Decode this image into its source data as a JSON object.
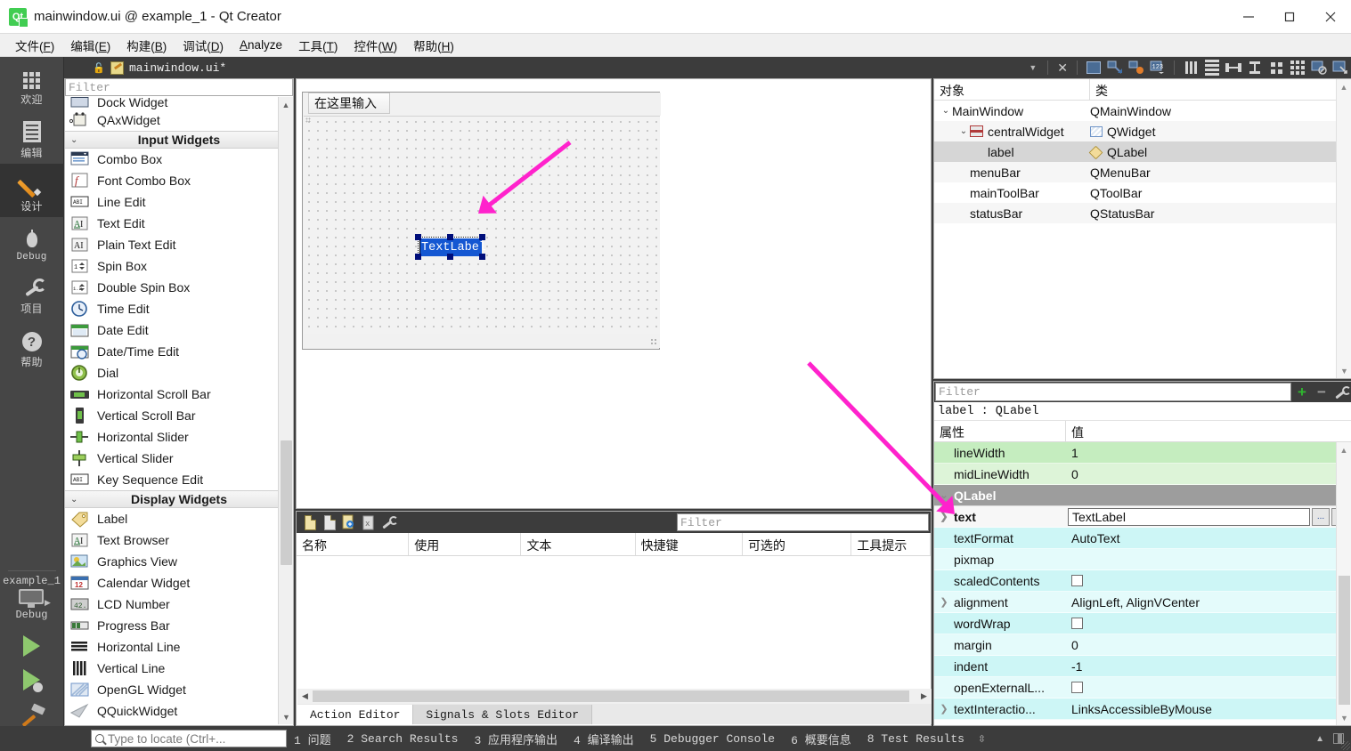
{
  "window": {
    "title": "mainwindow.ui @ example_1 - Qt Creator",
    "logo_text": "Qt",
    "minimize": "minimize-button",
    "maximize": "maximize-button",
    "close": "close-button"
  },
  "menubar": {
    "items": [
      {
        "label": "文件(F)",
        "mnemonic": "F"
      },
      {
        "label": "编辑(E)",
        "mnemonic": "E"
      },
      {
        "label": "构建(B)",
        "mnemonic": "B"
      },
      {
        "label": "调试(D)",
        "mnemonic": "D"
      },
      {
        "label": "Analyze",
        "mnemonic": "A"
      },
      {
        "label": "工具(T)",
        "mnemonic": "T"
      },
      {
        "label": "控件(W)",
        "mnemonic": "W"
      },
      {
        "label": "帮助(H)",
        "mnemonic": "H"
      }
    ]
  },
  "modebar": {
    "modes": [
      {
        "label": "欢迎",
        "icon": "grid-icon",
        "active": false
      },
      {
        "label": "编辑",
        "icon": "document-icon",
        "active": false
      },
      {
        "label": "设计",
        "icon": "pencil-icon",
        "active": true
      },
      {
        "label": "Debug",
        "icon": "bug-icon",
        "active": false
      },
      {
        "label": "项目",
        "icon": "wrench-icon",
        "active": false
      },
      {
        "label": "帮助",
        "icon": "question-icon",
        "active": false
      }
    ],
    "kit": {
      "project": "example_1",
      "config": "Debug",
      "run_label": "run-button",
      "debug_label": "start-debugging-button",
      "build_label": "build-button"
    }
  },
  "widgetbox": {
    "filter_placeholder": "Filter",
    "rows": [
      {
        "type": "item",
        "label": "Dock Widget",
        "icon": "dock-widget-icon",
        "clipped": true
      },
      {
        "type": "item",
        "label": "QAxWidget",
        "icon": "qaxwidget-icon"
      },
      {
        "type": "category",
        "label": "Input Widgets"
      },
      {
        "type": "item",
        "label": "Combo Box",
        "icon": "combo-box-icon"
      },
      {
        "type": "item",
        "label": "Font Combo Box",
        "icon": "font-combo-box-icon"
      },
      {
        "type": "item",
        "label": "Line Edit",
        "icon": "line-edit-icon"
      },
      {
        "type": "item",
        "label": "Text Edit",
        "icon": "text-edit-icon"
      },
      {
        "type": "item",
        "label": "Plain Text Edit",
        "icon": "plain-text-edit-icon"
      },
      {
        "type": "item",
        "label": "Spin Box",
        "icon": "spin-box-icon"
      },
      {
        "type": "item",
        "label": "Double Spin Box",
        "icon": "double-spin-box-icon"
      },
      {
        "type": "item",
        "label": "Time Edit",
        "icon": "time-edit-icon"
      },
      {
        "type": "item",
        "label": "Date Edit",
        "icon": "date-edit-icon"
      },
      {
        "type": "item",
        "label": "Date/Time Edit",
        "icon": "date-time-edit-icon"
      },
      {
        "type": "item",
        "label": "Dial",
        "icon": "dial-icon"
      },
      {
        "type": "item",
        "label": "Horizontal Scroll Bar",
        "icon": "horizontal-scroll-bar-icon"
      },
      {
        "type": "item",
        "label": "Vertical Scroll Bar",
        "icon": "vertical-scroll-bar-icon"
      },
      {
        "type": "item",
        "label": "Horizontal Slider",
        "icon": "horizontal-slider-icon"
      },
      {
        "type": "item",
        "label": "Vertical Slider",
        "icon": "vertical-slider-icon"
      },
      {
        "type": "item",
        "label": "Key Sequence Edit",
        "icon": "key-sequence-edit-icon"
      },
      {
        "type": "category",
        "label": "Display Widgets"
      },
      {
        "type": "item",
        "label": "Label",
        "icon": "label-icon"
      },
      {
        "type": "item",
        "label": "Text Browser",
        "icon": "text-browser-icon"
      },
      {
        "type": "item",
        "label": "Graphics View",
        "icon": "graphics-view-icon"
      },
      {
        "type": "item",
        "label": "Calendar Widget",
        "icon": "calendar-widget-icon"
      },
      {
        "type": "item",
        "label": "LCD Number",
        "icon": "lcd-number-icon"
      },
      {
        "type": "item",
        "label": "Progress Bar",
        "icon": "progress-bar-icon"
      },
      {
        "type": "item",
        "label": "Horizontal Line",
        "icon": "horizontal-line-icon"
      },
      {
        "type": "item",
        "label": "Vertical Line",
        "icon": "vertical-line-icon"
      },
      {
        "type": "item",
        "label": "OpenGL Widget",
        "icon": "opengl-widget-icon"
      },
      {
        "type": "item",
        "label": "QQuickWidget",
        "icon": "qquickwidget-icon"
      }
    ]
  },
  "form_toolbar": {
    "filename": "mainwindow.ui*",
    "lock_icon": "unlocked-icon",
    "dropdown_icon": "chevron-down-icon",
    "close_label": "close-document-button",
    "tools": [
      "edit-widgets-icon",
      "edit-signals-slots-icon",
      "edit-buddies-icon",
      "edit-tab-order-icon",
      "layout-horizontally-icon",
      "layout-vertically-icon",
      "layout-horizontal-splitter-icon",
      "layout-vertical-splitter-icon",
      "layout-in-form-icon",
      "layout-in-grid-icon",
      "break-layout-icon",
      "adjust-size-icon"
    ]
  },
  "canvas": {
    "form_menubar_hint": "在这里输入",
    "selected_widget_text": "TextLabel",
    "selected_widget_name": "label"
  },
  "action_editor": {
    "filter_placeholder": "Filter",
    "toolbar_icons": [
      "new-action-icon",
      "edit-action-icon",
      "copy-action-icon",
      "delete-action-icon",
      "configure-icon"
    ],
    "columns": [
      "名称",
      "使用",
      "文本",
      "快捷键",
      "可选的",
      "工具提示"
    ],
    "rows": [],
    "tabs": [
      {
        "label": "Action Editor",
        "active": true
      },
      {
        "label": "Signals & Slots Editor",
        "active": false
      }
    ]
  },
  "object_inspector": {
    "columns": [
      "对象",
      "类"
    ],
    "rows": [
      {
        "name": "MainWindow",
        "class": "QMainWindow",
        "depth": 0,
        "expandable": true,
        "icon": null,
        "class_icon": null,
        "selected": false
      },
      {
        "name": "centralWidget",
        "class": "QWidget",
        "depth": 1,
        "expandable": true,
        "icon": "central-widget-icon",
        "class_icon": "qwidget-icon",
        "selected": false
      },
      {
        "name": "label",
        "class": "QLabel",
        "depth": 2,
        "expandable": false,
        "icon": null,
        "class_icon": "qlabel-icon",
        "selected": true
      },
      {
        "name": "menuBar",
        "class": "QMenuBar",
        "depth": 1,
        "expandable": false,
        "icon": null,
        "class_icon": null,
        "selected": false
      },
      {
        "name": "mainToolBar",
        "class": "QToolBar",
        "depth": 1,
        "expandable": false,
        "icon": null,
        "class_icon": null,
        "selected": false
      },
      {
        "name": "statusBar",
        "class": "QStatusBar",
        "depth": 1,
        "expandable": false,
        "icon": null,
        "class_icon": null,
        "selected": false
      }
    ]
  },
  "property_editor": {
    "filter_placeholder": "Filter",
    "add_icon": "plus-icon",
    "remove_icon": "minus-icon",
    "configure_icon": "configure-icon",
    "object_header": "label : QLabel",
    "columns": [
      "属性",
      "值"
    ],
    "rows": [
      {
        "name": "lineWidth",
        "value": "1",
        "tone": "green",
        "expandable": false,
        "bold": false,
        "kind": "text"
      },
      {
        "name": "midLineWidth",
        "value": "0",
        "tone": "green2",
        "expandable": false,
        "bold": false,
        "kind": "text"
      },
      {
        "name": "QLabel",
        "value": "",
        "tone": "group",
        "expandable": true,
        "bold": true,
        "kind": "group"
      },
      {
        "name": "text",
        "value": "TextLabel",
        "tone": "white",
        "expandable": true,
        "bold": true,
        "kind": "editor"
      },
      {
        "name": "textFormat",
        "value": "AutoText",
        "tone": "cy1",
        "expandable": false,
        "bold": false,
        "kind": "text"
      },
      {
        "name": "pixmap",
        "value": "",
        "tone": "cy2",
        "expandable": false,
        "bold": false,
        "kind": "text"
      },
      {
        "name": "scaledContents",
        "value": "",
        "tone": "cy1",
        "expandable": false,
        "bold": false,
        "kind": "checkbox"
      },
      {
        "name": "alignment",
        "value": "AlignLeft, AlignVCenter",
        "tone": "cy2",
        "expandable": true,
        "bold": false,
        "kind": "text"
      },
      {
        "name": "wordWrap",
        "value": "",
        "tone": "cy1",
        "expandable": false,
        "bold": false,
        "kind": "checkbox"
      },
      {
        "name": "margin",
        "value": "0",
        "tone": "cy2",
        "expandable": false,
        "bold": false,
        "kind": "text"
      },
      {
        "name": "indent",
        "value": "-1",
        "tone": "cy1",
        "expandable": false,
        "bold": false,
        "kind": "text"
      },
      {
        "name": "openExternalL...",
        "value": "",
        "tone": "cy2",
        "expandable": false,
        "bold": false,
        "kind": "checkbox"
      },
      {
        "name": "textInteractio...",
        "value": "LinksAccessibleByMouse",
        "tone": "cy1",
        "expandable": true,
        "bold": false,
        "kind": "text"
      }
    ],
    "editor_buttons": {
      "browse": "...",
      "reset": "reset-icon"
    }
  },
  "statusbar": {
    "locator_placeholder": "Type to locate (Ctrl+...",
    "search_icon": "search-icon",
    "outputs": [
      "1 问题",
      "2 Search Results",
      "3 应用程序输出",
      "4 编译输出",
      "5 Debugger Console",
      "6 概要信息",
      "8 Test Results"
    ],
    "spinner": "spin-updown-icon",
    "collapse_icon": "chevron-up-icon",
    "split_icon": "split-view-icon"
  },
  "colors": {
    "accent_arrow": "#ff22cc",
    "selection_blue": "#1457d2",
    "handle_navy": "#000e7a",
    "qt_green": "#41cd52",
    "prop_green": "#c5edbf",
    "prop_cyan": "#cdf6f6",
    "group_gray": "#9d9d9d"
  }
}
